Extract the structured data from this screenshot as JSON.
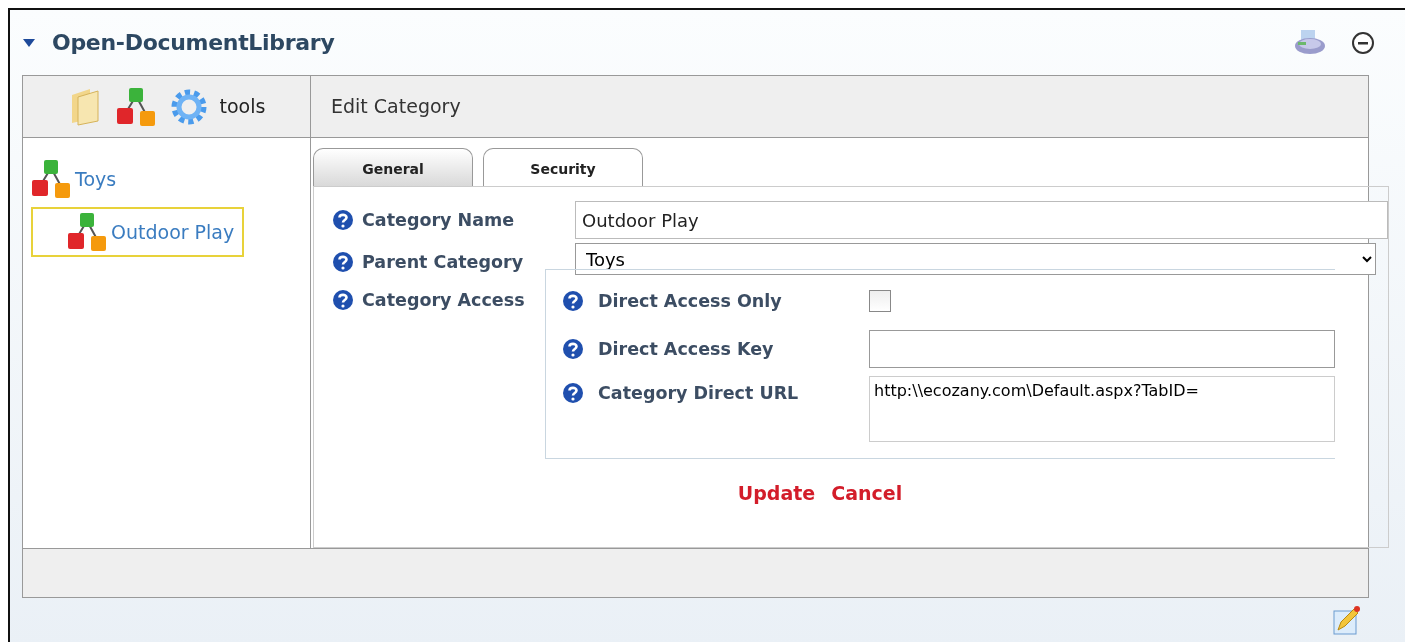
{
  "module": {
    "title": "Open-DocumentLibrary",
    "expanded": true
  },
  "toolbar": {
    "label": "tools"
  },
  "tree": [
    {
      "label": "Toys",
      "selected": false,
      "children": [
        {
          "label": "Outdoor Play",
          "selected": true
        }
      ]
    }
  ],
  "panel_title": "Edit Category",
  "tabs": [
    {
      "label": "General",
      "selected": true
    },
    {
      "label": "Security",
      "selected": false
    }
  ],
  "fields": [
    {
      "label": "Category Name",
      "kind": "text",
      "value": "Outdoor Play"
    },
    {
      "label": "Parent Category",
      "kind": "select",
      "value": "Toys"
    },
    {
      "label": "Category Access",
      "kind": "group",
      "items": [
        {
          "label": "Direct Access Only",
          "kind": "checkbox",
          "checked": false
        },
        {
          "label": "Direct Access Key",
          "kind": "text"
        },
        {
          "label": "Category Direct URL",
          "kind": "textarea",
          "value": "http:\\\\ecozany.com\\Default.aspx?TabID="
        }
      ]
    }
  ],
  "actions": [
    {
      "label": "Update"
    },
    {
      "label": "Cancel"
    }
  ]
}
